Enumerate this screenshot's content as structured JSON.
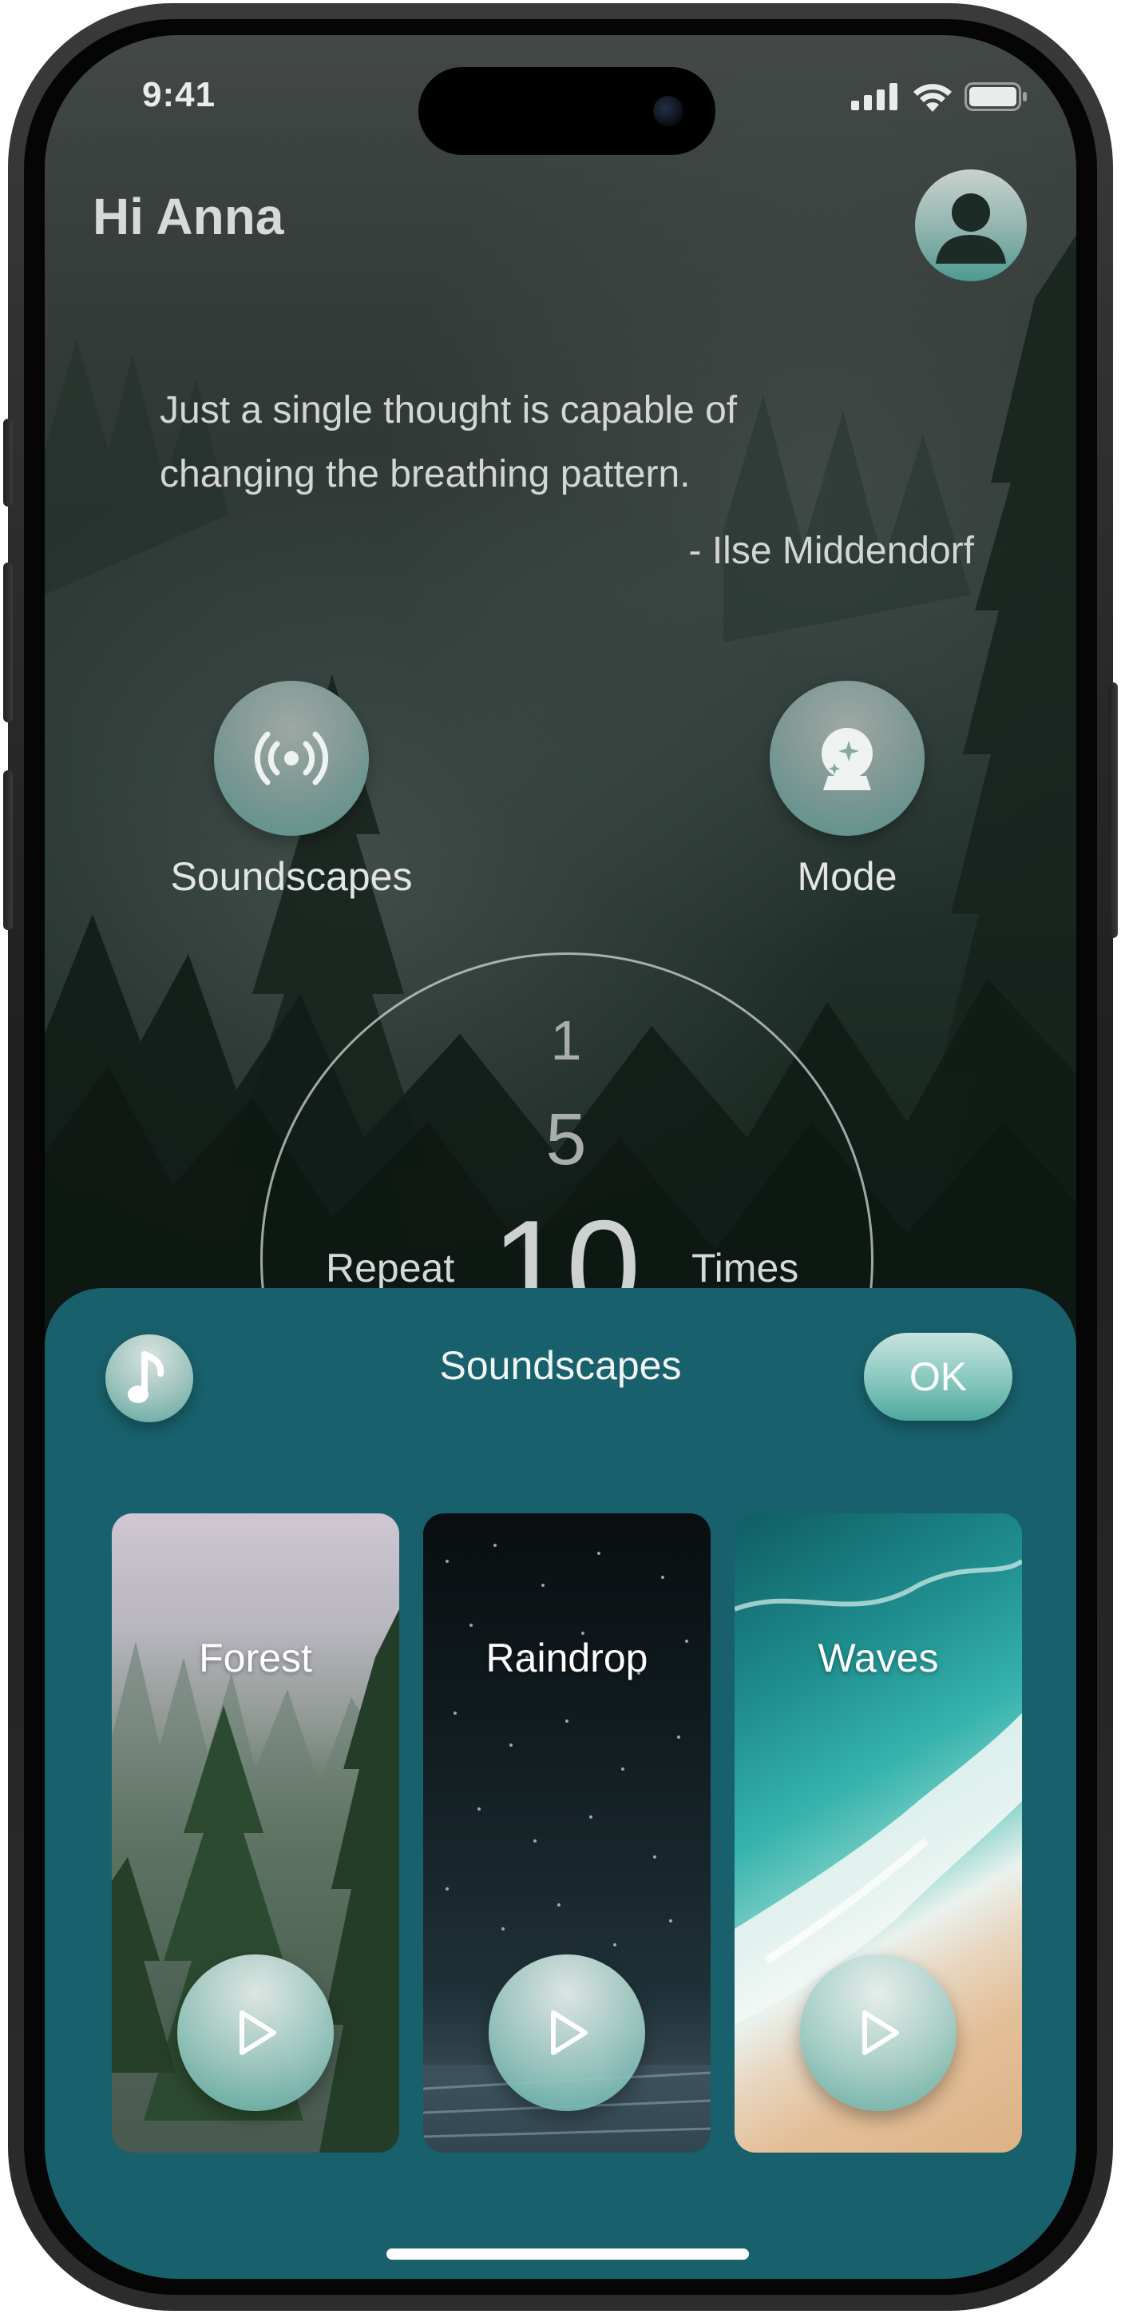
{
  "status_bar": {
    "time": "9:41"
  },
  "header": {
    "greeting": "Hi Anna"
  },
  "quote": {
    "text": "Just a single thought is capable of changing the breathing pattern.",
    "author": "- Ilse Middendorf"
  },
  "options": [
    {
      "label": "Soundscapes",
      "icon": "broadcast-icon"
    },
    {
      "label": "Mode",
      "icon": "crystal-ball-icon"
    }
  ],
  "repeat_dial": {
    "prefix": "Repeat",
    "suffix": "Times",
    "values": [
      "1",
      "5",
      "10"
    ],
    "selected": "10"
  },
  "soundscapes_sheet": {
    "title": "Soundscapes",
    "icon": "music-note-icon",
    "ok_label": "OK",
    "background_color": "#18606b",
    "cards": [
      {
        "label": "Forest",
        "play_icon": "play-icon"
      },
      {
        "label": "Raindrop",
        "play_icon": "play-icon"
      },
      {
        "label": "Waves",
        "play_icon": "play-icon"
      }
    ]
  }
}
